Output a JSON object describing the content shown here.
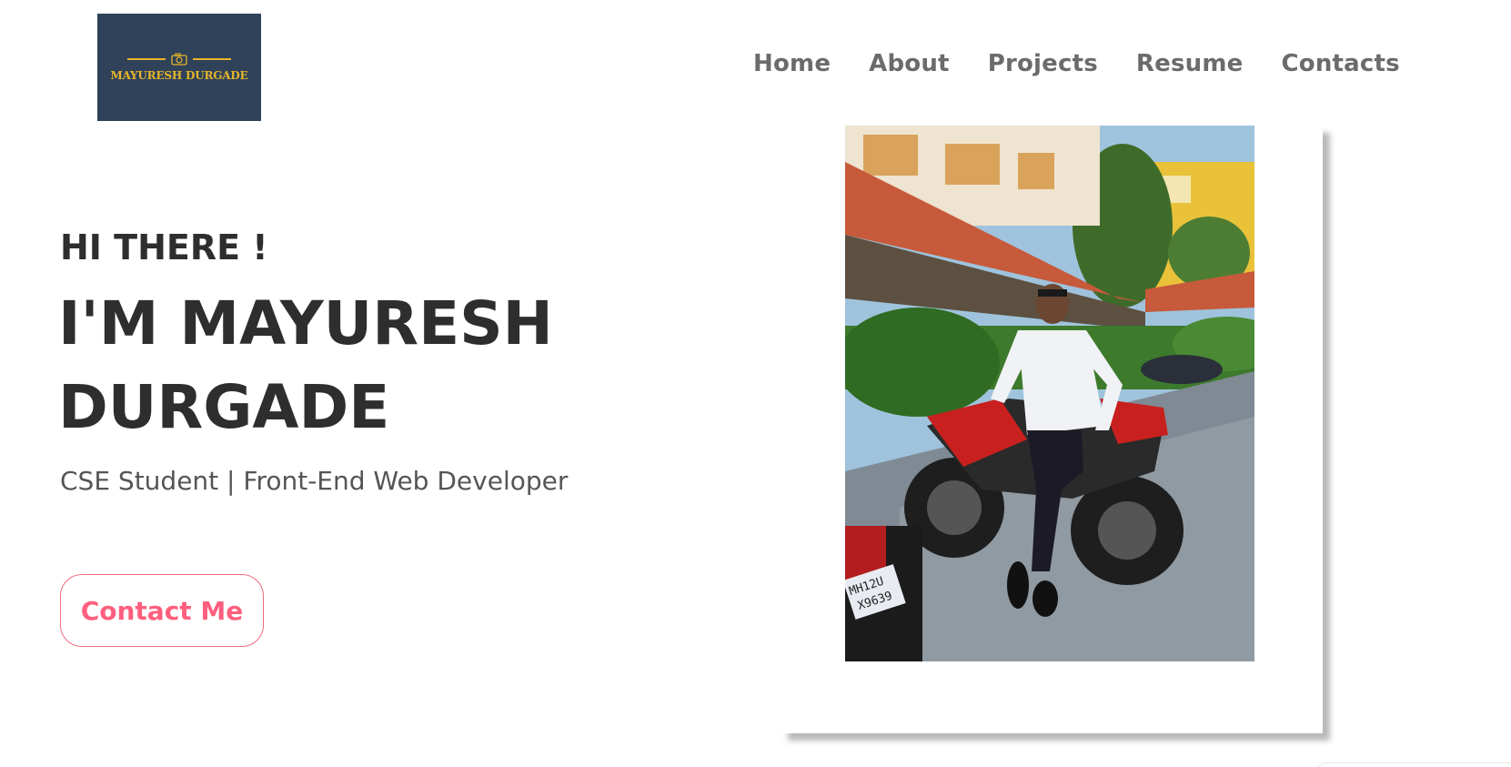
{
  "logo": {
    "text": "MAYURESH DURGADE",
    "icon": "camera-icon",
    "colors": {
      "background": "#2f4259",
      "accent": "#e7b52a"
    }
  },
  "nav": {
    "items": [
      {
        "label": "Home"
      },
      {
        "label": "About"
      },
      {
        "label": "Projects"
      },
      {
        "label": "Resume"
      },
      {
        "label": "Contacts"
      }
    ]
  },
  "hero": {
    "greeting": "HI THERE !",
    "name": "I'M MAYURESH DURGADE",
    "subtitle": "CSE Student | Front-End Web Developer",
    "cta_label": "Contact Me"
  },
  "photo": {
    "plate_text_1": "MH12U",
    "plate_text_2": "X9639"
  },
  "colors": {
    "text_dark": "#2e2e2e",
    "nav_text": "#6b6b6b",
    "cta_accent": "#ff5f7e"
  }
}
